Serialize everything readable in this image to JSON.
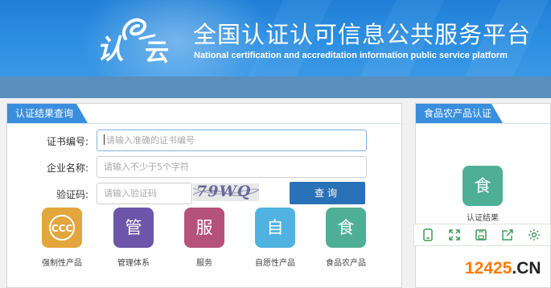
{
  "header": {
    "logo_ren": "认",
    "logo_yun": "云",
    "title_cn": "全国认证认可信息公共服务平台",
    "title_en": "National certification and accreditation information public service platform"
  },
  "left_panel": {
    "tab": "认证结果查询",
    "form": {
      "cert_label": "证书编号:",
      "cert_placeholder": "请输入准确的证书编号",
      "company_label": "企业名称:",
      "company_placeholder": "请输入不少于5个字符",
      "captcha_label": "验证码:",
      "captcha_placeholder": "请输入验证码",
      "captcha_text": "79WQ",
      "query_button": "查询"
    },
    "categories": [
      {
        "label": "强制性产品",
        "glyph": "CCC",
        "color": "#e3a63c"
      },
      {
        "label": "管理体系",
        "glyph": "管",
        "color": "#6d55a9"
      },
      {
        "label": "服务",
        "glyph": "服",
        "color": "#b5527a"
      },
      {
        "label": "自愿性产品",
        "glyph": "自",
        "color": "#4fb2e0"
      },
      {
        "label": "食品农产品",
        "glyph": "食",
        "color": "#4fae96"
      }
    ]
  },
  "right_panel": {
    "tab": "食品农产品认证",
    "item_glyph": "食",
    "item_label": "认证结果"
  },
  "toolbar": {
    "icons": [
      "phone-icon",
      "fullscreen-icon",
      "save-icon",
      "share-icon",
      "settings-icon"
    ],
    "color": "#3f9a5a"
  },
  "watermark": {
    "part1": "12425",
    "part2": ".CN"
  }
}
